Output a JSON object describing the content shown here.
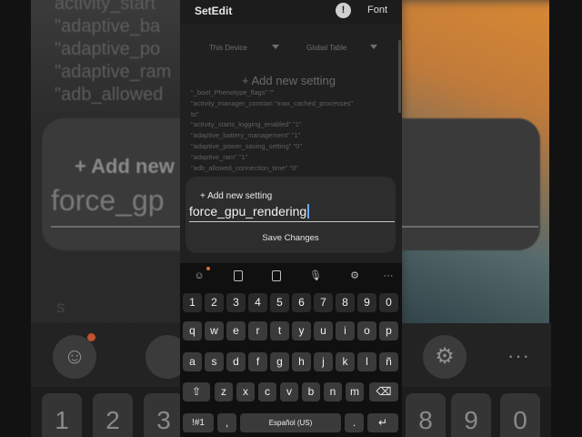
{
  "background": {
    "list": [
      "activity_start",
      "\"adaptive_ba",
      "\"adaptive_po",
      "\"adaptive_ram",
      "\"adb_allowed"
    ],
    "card_title": "+ Add new",
    "card_input": "force_gp",
    "s_char": "S",
    "keys": [
      "1",
      "2",
      "3",
      "8",
      "9",
      "0"
    ]
  },
  "app": {
    "title": "SetEdit",
    "font_button": "Font",
    "settings_icon_glyph": "!",
    "device_dropdown": "This Device",
    "table_dropdown": "Global Table",
    "add_setting": "+ Add new setting",
    "settings_list": [
      "\"_boot_Phenotype_flags\"   \"\"",
      "\"activity_manager_constan    \"max_cached_processes\"",
      "ts\"",
      "\"activity_starts_logging_enabled\"    \"1\"",
      "\"adaptive_battery_management\"    \"1\"",
      "\"adaptive_power_saving_setting\"    \"0\"",
      "\"adaptive_ram\"    \"1\"",
      "\"adb_allowed_connection_time\"    \"0\""
    ]
  },
  "dialog": {
    "title": "+ Add new setting",
    "input_value": "force_gpu_rendering",
    "save_label": "Save Changes"
  },
  "keyboard": {
    "toolbar_icons": [
      "emoji-icon",
      "clipboard-icon",
      "text-edit-icon",
      "microphone-icon",
      "gear-icon",
      "more-icon"
    ],
    "toolbar_glyphs": {
      "emoji": "☺",
      "mic": "🎙",
      "gear": "⚙",
      "more": "···"
    },
    "numbers": [
      "1",
      "2",
      "3",
      "4",
      "5",
      "6",
      "7",
      "8",
      "9",
      "0"
    ],
    "row1": [
      "q",
      "w",
      "e",
      "r",
      "t",
      "y",
      "u",
      "i",
      "o",
      "p"
    ],
    "row2": [
      "a",
      "s",
      "d",
      "f",
      "g",
      "h",
      "j",
      "k",
      "l",
      "ñ"
    ],
    "row3": [
      "z",
      "x",
      "c",
      "v",
      "b",
      "n",
      "m"
    ],
    "shift": "⇧",
    "backspace": "⌫",
    "symbols": "!#1",
    "comma": ",",
    "space": "Español (US)",
    "period": ".",
    "enter": "↵"
  },
  "colors": {
    "accent_caret": "#6aa7ff",
    "notification_dot": "#e06a3b",
    "background_warm": "#d98a32"
  }
}
